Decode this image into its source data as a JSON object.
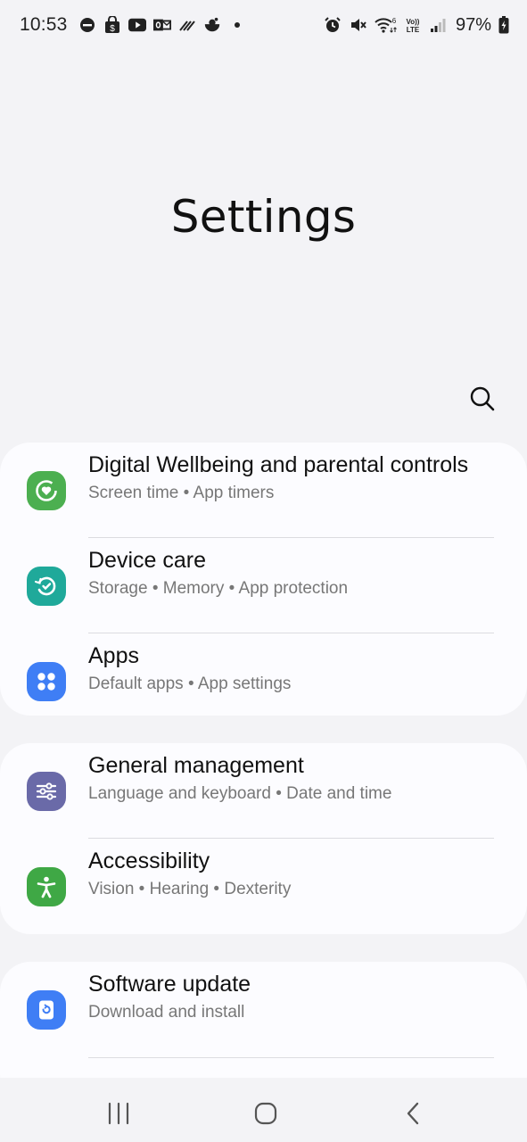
{
  "status_bar": {
    "time": "10:53",
    "battery": "97%",
    "left_icons": [
      "dnd-icon",
      "shopping-bag-icon",
      "youtube-icon",
      "outlook-icon",
      "wifi-calling-icon",
      "app-notification-icon",
      "more-dot-icon"
    ],
    "right_icons": [
      "alarm-icon",
      "mute-icon",
      "wifi-6-icon",
      "volte-icon",
      "signal-icon",
      "battery-icon"
    ]
  },
  "page": {
    "title": "Settings"
  },
  "groups": [
    {
      "items": [
        {
          "label": "Digital Wellbeing and parental controls",
          "subtitle": "Screen time  •  App timers",
          "icon": "digital-wellbeing-icon",
          "color": "#4caf50"
        },
        {
          "label": "Device care",
          "subtitle": "Storage  •  Memory  •  App protection",
          "icon": "device-care-icon",
          "color": "#1fa99a"
        },
        {
          "label": "Apps",
          "subtitle": "Default apps  •  App settings",
          "icon": "apps-icon",
          "color": "#3f7ef5"
        }
      ]
    },
    {
      "items": [
        {
          "label": "General management",
          "subtitle": "Language and keyboard  •  Date and time",
          "icon": "general-management-icon",
          "color": "#6a6aa8"
        },
        {
          "label": "Accessibility",
          "subtitle": "Vision  •  Hearing  •  Dexterity",
          "icon": "accessibility-icon",
          "color": "#3fa845"
        }
      ]
    },
    {
      "items": [
        {
          "label": "Software update",
          "subtitle": "Download and install",
          "icon": "software-update-icon",
          "color": "#3f7ef5"
        }
      ]
    }
  ],
  "nav_bar": {
    "buttons": [
      "recents-icon",
      "home-icon",
      "back-icon"
    ]
  }
}
